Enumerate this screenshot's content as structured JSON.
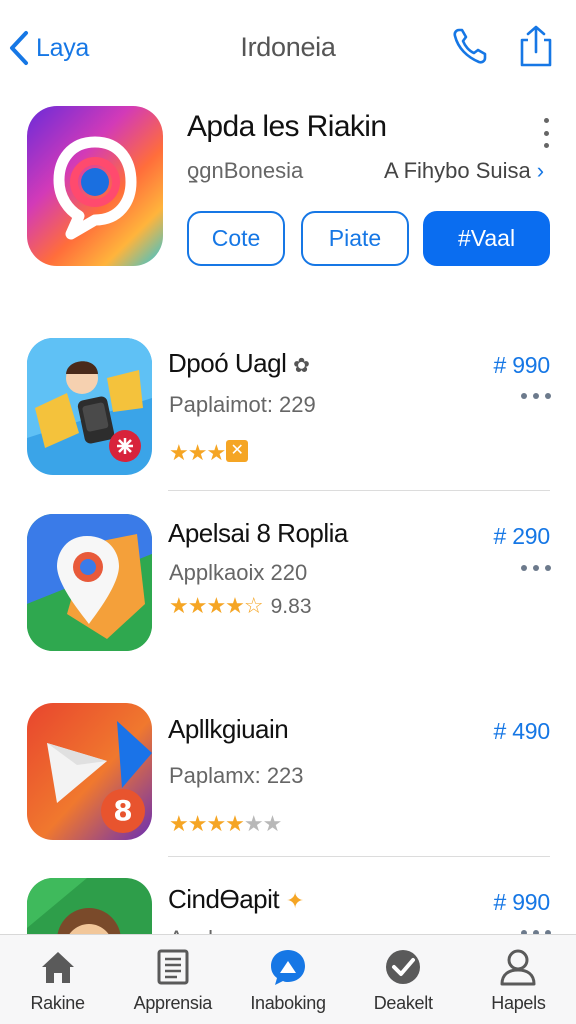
{
  "nav": {
    "back_label": "Laya",
    "title": "Irdoneia",
    "phone_icon": "phone-icon",
    "share_icon": "share-icon",
    "accent": "#1677e5"
  },
  "featured": {
    "icon": "speech-bubble-app-icon",
    "title": "Apda les Riakin",
    "developer": "ƍgnBonesia",
    "link_label": "A Fihybo Suisa",
    "buttons": [
      "Cote",
      "Piate",
      "#Vaal"
    ]
  },
  "apps": [
    {
      "icon": "character-phone-app-icon",
      "title": "Dpoó Uagl",
      "title_badge": "✿",
      "subtitle": "Paplaimot: 229",
      "price": "# 990",
      "stars": 3,
      "star_style": "badge",
      "rating_text": ""
    },
    {
      "icon": "map-pin-app-icon",
      "title": "Apelsai 8 Roplia",
      "title_badge": "",
      "subtitle": "Applkaoix 220",
      "price": "# 290",
      "stars": 4,
      "star_style": "half",
      "rating_text": "9.83"
    },
    {
      "icon": "play-triangle-app-icon",
      "title": "Apllkgiuain",
      "title_badge": "",
      "subtitle": "Paplamx: 223",
      "price": "# 490",
      "stars": 4,
      "star_style": "plain",
      "rating_text": ""
    },
    {
      "icon": "character-face-app-icon",
      "title": "CindƟapit",
      "title_badge": "✦",
      "subtitle": "Anpk...",
      "price": "# 990",
      "stars": 0,
      "star_style": "plain",
      "rating_text": ""
    }
  ],
  "tabs": [
    {
      "label": "Rakine",
      "icon": "home-icon"
    },
    {
      "label": "Apprensia",
      "icon": "list-icon"
    },
    {
      "label": "Inaboking",
      "icon": "chat-icon"
    },
    {
      "label": "Deakelt",
      "icon": "check-circle-icon"
    },
    {
      "label": "Hapels",
      "icon": "profile-icon"
    }
  ]
}
